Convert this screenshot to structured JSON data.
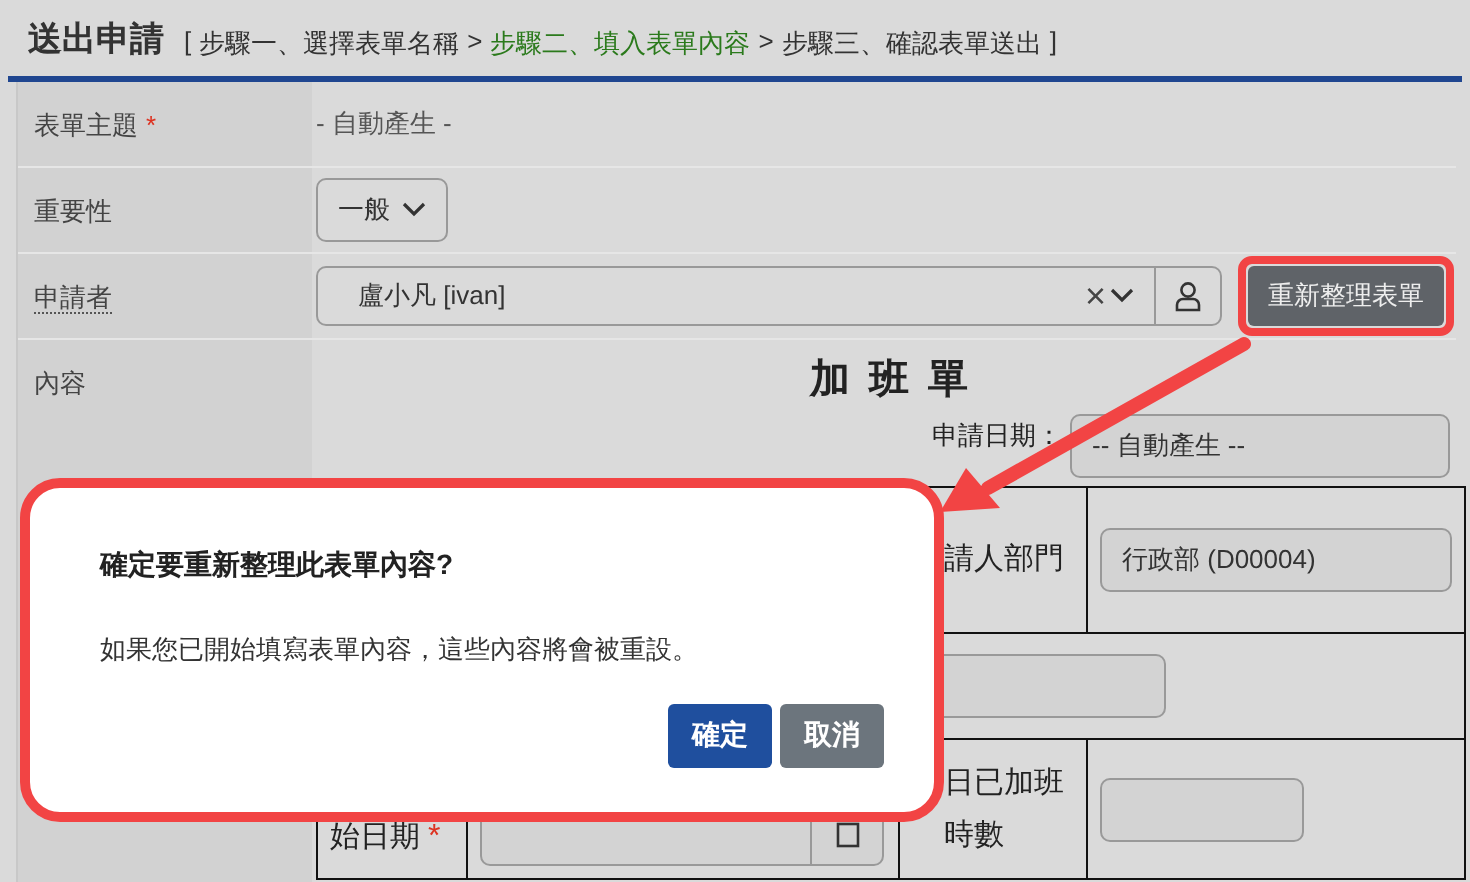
{
  "required_mark": "*",
  "header": {
    "title": "送出申請",
    "bracket_open": "[",
    "bracket_close": "]",
    "separator": ">",
    "steps": [
      {
        "label": "步驟一、選擇表單名稱",
        "selected": false
      },
      {
        "label": "步驟二、填入表單內容",
        "selected": true
      },
      {
        "label": "步驟三、確認表單送出",
        "selected": false
      }
    ]
  },
  "fields": [
    {
      "kind": "text",
      "label": "表單主題",
      "required": true,
      "value": "- 自動產生 -"
    },
    {
      "kind": "select",
      "label": "重要性",
      "required": false,
      "value": "一般"
    },
    {
      "kind": "person",
      "label": "申請者",
      "required": false,
      "value": "盧小凡 [ivan]",
      "clear": "×",
      "action": {
        "label": "重新整理表單",
        "highlighted": true
      }
    },
    {
      "kind": "content",
      "label": "內容",
      "required": false
    }
  ],
  "form": {
    "title": "加 班 單",
    "date_label": "申請日期：",
    "date_value": "-- 自動產生 --",
    "rows": [
      {
        "kind": "pair",
        "label": "",
        "value": "",
        "label_2": "請人部門",
        "value_2": "行政部 (D00004)"
      },
      {
        "kind": "wide",
        "label": "",
        "value": ""
      },
      {
        "kind": "date",
        "label": "始日期",
        "required": true,
        "value": "",
        "label_2": "日已加班時數",
        "value_2": ""
      }
    ]
  },
  "dialog": {
    "title": "確定要重新整理此表單內容?",
    "message": "如果您已開始填寫表單內容，這些內容將會被重設。",
    "highlighted": true,
    "buttons": [
      {
        "kind": "primary",
        "label": "確定"
      },
      {
        "kind": "secondary",
        "label": "取消"
      }
    ]
  }
}
